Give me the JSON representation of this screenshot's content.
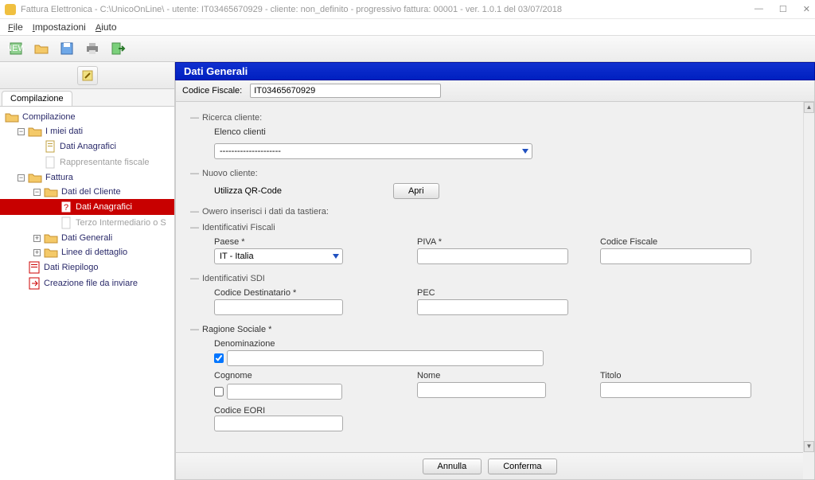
{
  "titlebar": {
    "text": "Fattura Elettronica - C:\\UnicoOnLine\\ - utente: IT03465670929 - cliente: non_definito - progressivo fattura: 00001     - ver. 1.0.1 del 03/07/2018"
  },
  "menubar": {
    "file": "File",
    "impostazioni": "Impostazioni",
    "aiuto": "Aiuto"
  },
  "sidebar": {
    "tab": "Compilazione",
    "items": {
      "compilazione": "Compilazione",
      "miei_dati": "I miei dati",
      "dati_anagrafici_1": "Dati Anagrafici",
      "rappr_fiscale": "Rappresentante fiscale",
      "fattura": "Fattura",
      "dati_cliente": "Dati del Cliente",
      "dati_anagrafici_2": "Dati Anagrafici",
      "terzo_intermediario": "Terzo Intermediario o S",
      "dati_generali": "Dati Generali",
      "linee_dettaglio": "Linee di dettaglio",
      "dati_riepilogo": "Dati Riepilogo",
      "creazione_file": "Creazione file da inviare"
    }
  },
  "panel": {
    "title": "Dati Generali",
    "cf_label": "Codice Fiscale:",
    "cf_value": "IT03465670929",
    "ricerca_cliente": "Ricerca cliente:",
    "elenco_clienti": "Elenco clienti",
    "elenco_placeholder": "---------------------",
    "nuovo_cliente": "Nuovo cliente:",
    "utilizza_qr": "Utilizza QR-Code",
    "apri": "Apri",
    "owero": "Owero inserisci i dati da tastiera:",
    "id_fiscali": "Identificativi Fiscali",
    "paese": "Paese",
    "paese_value": "IT - Italia",
    "piva": "PIVA",
    "codice_fiscale": "Codice Fiscale",
    "id_sdi": "Identificativi SDI",
    "cod_dest": "Codice Destinatario",
    "pec": "PEC",
    "ragione_sociale": "Ragione Sociale",
    "denominazione": "Denominazione",
    "cognome": "Cognome",
    "nome": "Nome",
    "titolo": "Titolo",
    "codice_eori": "Codice EORI",
    "annulla": "Annulla",
    "conferma": "Conferma"
  }
}
